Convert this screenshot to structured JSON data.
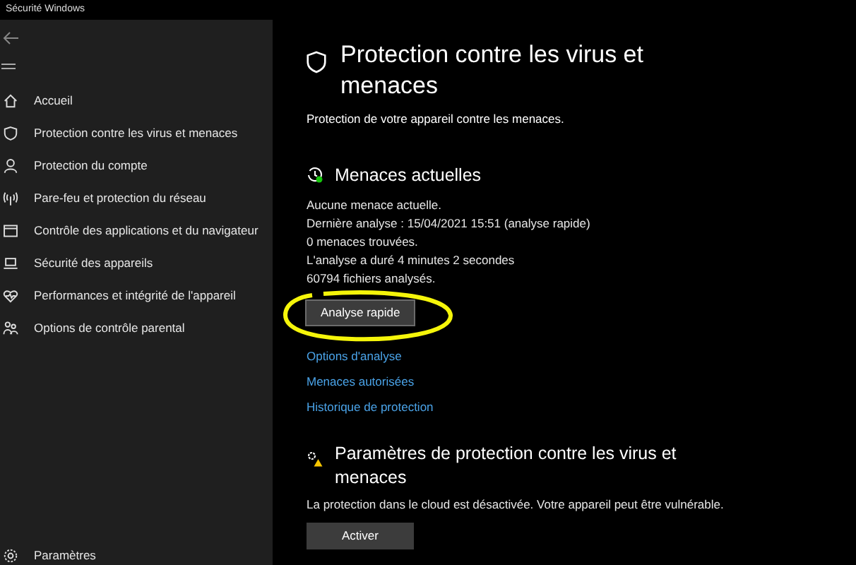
{
  "window": {
    "title": "Sécurité Windows"
  },
  "sidebar": {
    "items": [
      {
        "kind": "home",
        "label": "Accueil"
      },
      {
        "kind": "shield",
        "label": "Protection contre les virus et menaces"
      },
      {
        "kind": "person",
        "label": "Protection du compte"
      },
      {
        "kind": "wifi",
        "label": "Pare-feu et protection du réseau"
      },
      {
        "kind": "window",
        "label": "Contrôle des applications et du navigateur"
      },
      {
        "kind": "laptop",
        "label": "Sécurité des appareils"
      },
      {
        "kind": "heart",
        "label": "Performances et intégrité de l'appareil"
      },
      {
        "kind": "family",
        "label": "Options de contrôle parental"
      }
    ],
    "settings": "Paramètres"
  },
  "main": {
    "title": "Protection contre les virus et menaces",
    "subtitle": "Protection de votre appareil contre les menaces.",
    "threats": {
      "heading": "Menaces actuelles",
      "lines": [
        "Aucune menace actuelle.",
        "Dernière analyse : 15/04/2021 15:51 (analyse rapide)",
        "0 menaces trouvées.",
        "L'analyse a duré 4 minutes 2 secondes",
        "60794 fichiers analysés."
      ],
      "button": "Analyse rapide",
      "links": [
        "Options d'analyse",
        "Menaces autorisées",
        "Historique de protection"
      ]
    },
    "settings": {
      "heading": "Paramètres de protection contre les virus et menaces",
      "text": "La protection dans le cloud est désactivée. Votre appareil peut être vulnérable.",
      "button": "Activer"
    }
  }
}
